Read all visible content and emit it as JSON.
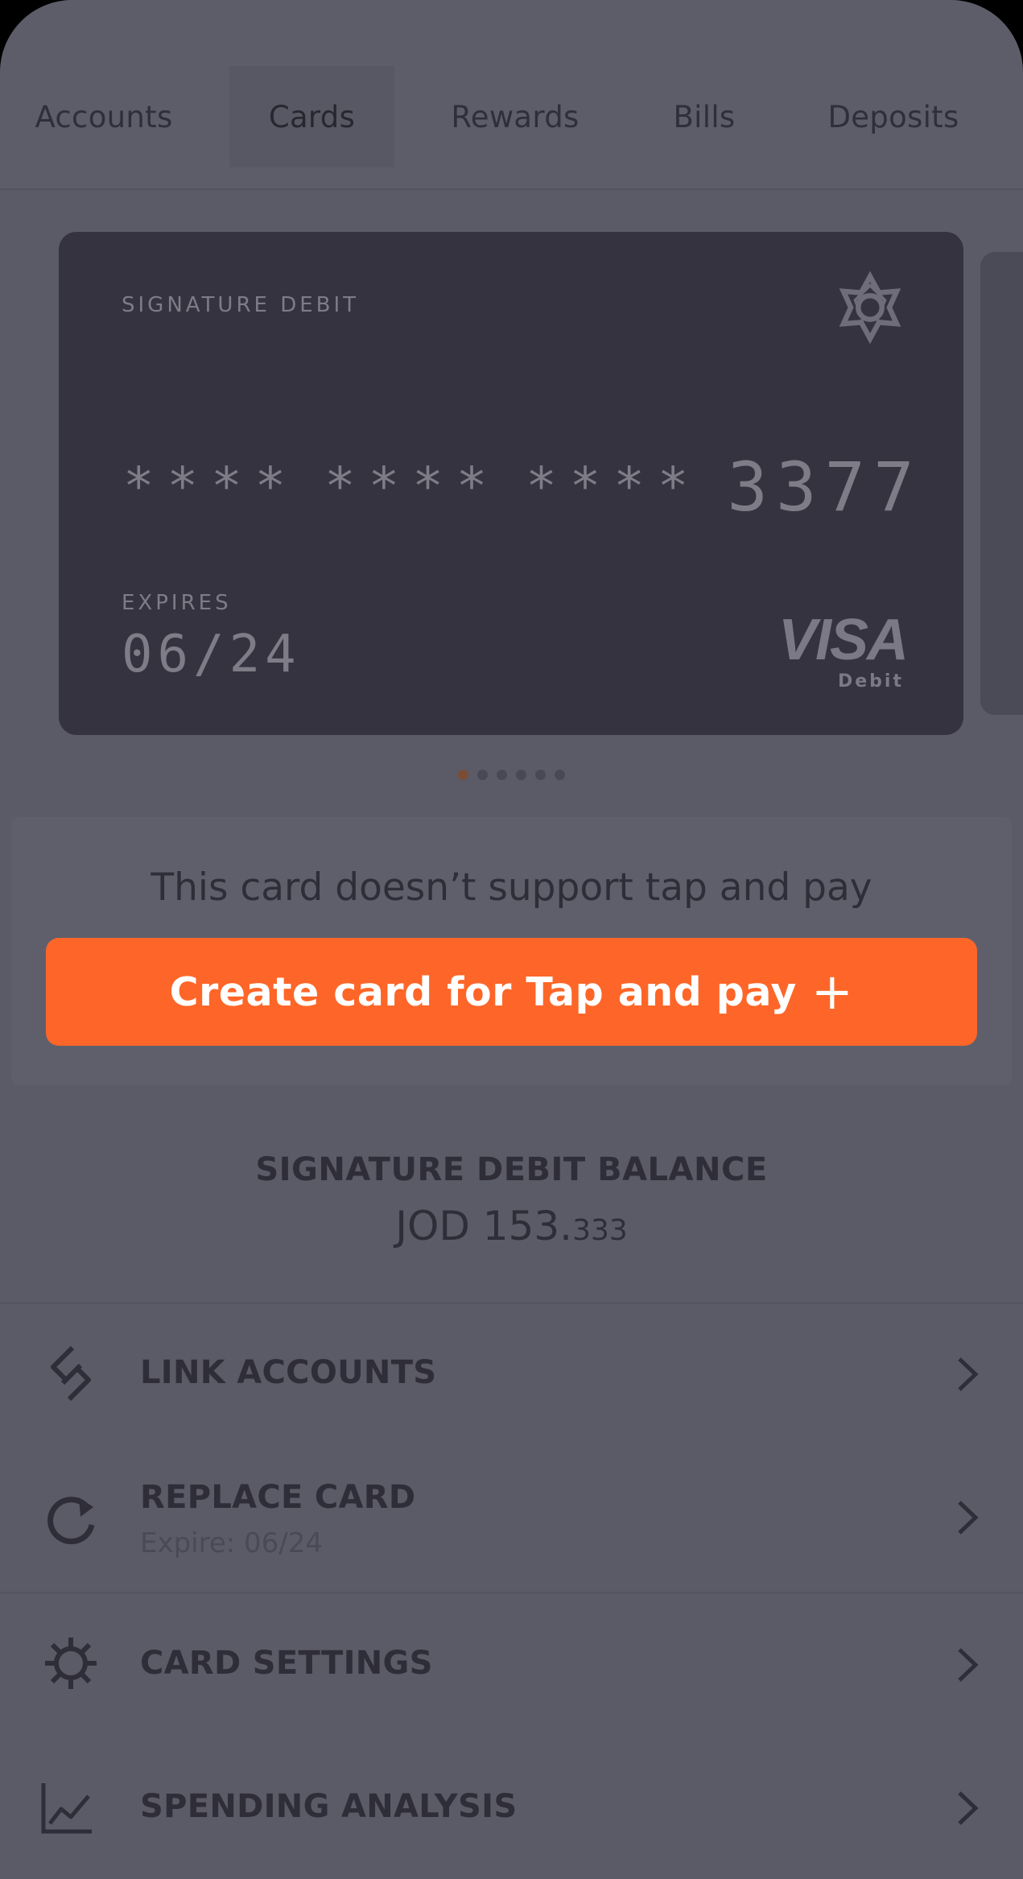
{
  "tabs": [
    {
      "label": "Accounts"
    },
    {
      "label": "Cards"
    },
    {
      "label": "Rewards"
    },
    {
      "label": "Bills"
    },
    {
      "label": "Deposits"
    }
  ],
  "active_tab": "Cards",
  "card": {
    "type": "SIGNATURE DEBIT",
    "masked_groups": [
      "****",
      "****",
      "****"
    ],
    "last4": "3377",
    "expires_label": "EXPIRES",
    "expires_value": "06/24",
    "network": "VISA",
    "network_sub": "Debit",
    "logo_icon": "bank-flower-logo"
  },
  "carousel": {
    "total": 6,
    "active_index": 0
  },
  "tap_pay": {
    "message": "This card doesn’t support tap and pay",
    "button_label": "Create card for Tap and pay",
    "button_icon": "+"
  },
  "balance": {
    "title": "SIGNATURE DEBIT BALANCE",
    "currency": "JOD",
    "integer": "153.",
    "decimal": "333"
  },
  "menu": [
    {
      "label": "LINK ACCOUNTS",
      "icon": "link-icon"
    },
    {
      "label": "REPLACE CARD",
      "sub": "Expire: 06/24",
      "icon": "refresh-icon"
    },
    {
      "label": "CARD SETTINGS",
      "icon": "gear-icon"
    },
    {
      "label": "SPENDING ANALYSIS",
      "icon": "chart-icon"
    }
  ],
  "colors": {
    "accent": "#fd6628",
    "background": "#5b5b68",
    "card": "#34333f",
    "text": "#2e2d38"
  }
}
